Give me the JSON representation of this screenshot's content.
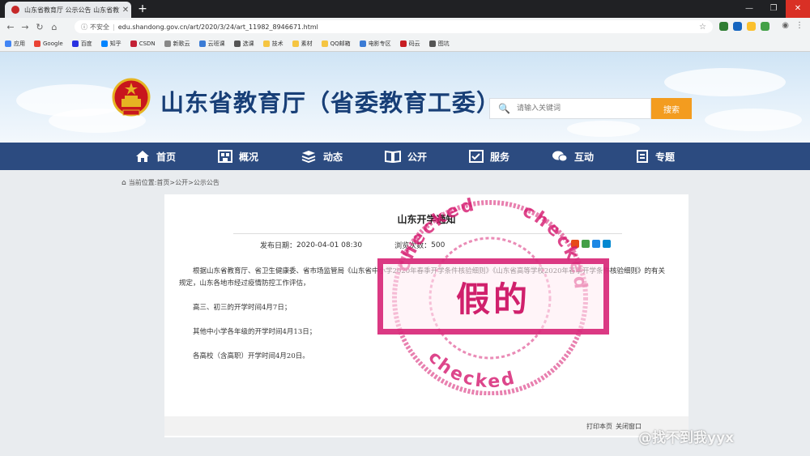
{
  "browser": {
    "tab_title": "山东省教育厅 公示公告 山东省教育...",
    "new_tab_symbol": "+",
    "window_buttons": [
      "—",
      "❐",
      "✕"
    ],
    "security_text": "不安全",
    "url": "edu.shandong.gov.cn/art/2020/3/24/art_11982_8946671.html",
    "bookmarks": [
      {
        "label": "应用",
        "color": "#4285f4"
      },
      {
        "label": "Google",
        "color": "#ea4335"
      },
      {
        "label": "百度",
        "color": "#2932e1"
      },
      {
        "label": "知乎",
        "color": "#0084ff"
      },
      {
        "label": "CSDN",
        "color": "#c32136"
      },
      {
        "label": "新歌云",
        "color": "#888888"
      },
      {
        "label": "云班课",
        "color": "#3a7bd5"
      },
      {
        "label": "选课",
        "color": "#555555"
      },
      {
        "label": "技术",
        "color": "#f5c542"
      },
      {
        "label": "素材",
        "color": "#f5c542"
      },
      {
        "label": "QQ邮箱",
        "color": "#f5c542"
      },
      {
        "label": "电影专区",
        "color": "#3a7bd5"
      },
      {
        "label": "码云",
        "color": "#c71d23"
      },
      {
        "label": "图坑",
        "color": "#555555"
      }
    ]
  },
  "site": {
    "title": "山东省教育厅（省委教育工委）",
    "search_placeholder": "请输入关键词",
    "search_button": "搜索",
    "nav": [
      "首页",
      "概况",
      "动态",
      "公开",
      "服务",
      "互动",
      "专题"
    ],
    "breadcrumb": {
      "prefix": "当前位置:",
      "items": [
        "首页",
        "公开",
        "公示公告"
      ],
      "separator": ">"
    }
  },
  "article": {
    "title": "山东开学通知",
    "meta_date_label": "发布日期：",
    "meta_date": "2020-04-01 08:30",
    "meta_views_label": "浏览次数：",
    "meta_views": "500",
    "paragraphs": [
      "根据山东省教育厅、省卫生健康委、省市场监管局《山东省中小学2020年春季开学条件核验细则》《山东省高等学校2020年春季开学条件核验细则》的有关规定，山东各地市经过疫情防控工作评估，",
      "高三、初三的开学时间4月7日；",
      "其他中小学各年级的开学时间4月13日；",
      "各高校（含高职）开学时间4月20日。"
    ],
    "footer_links": [
      "打印本页",
      "关闭窗口"
    ]
  },
  "stamp": {
    "ring_text": "checked",
    "label": "假的",
    "color": "#d5186e"
  },
  "watermark": "@找不到我yyx",
  "colors": {
    "nav_bg": "#2c4b80",
    "title": "#183f77",
    "search_btn": "#f39c1f"
  }
}
